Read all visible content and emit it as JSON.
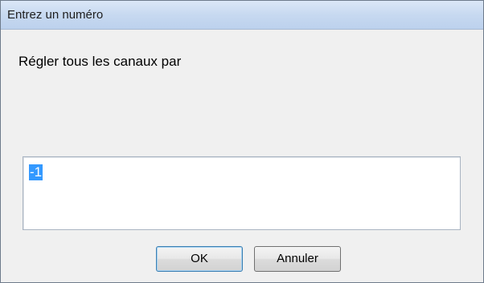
{
  "window": {
    "title": "Entrez un numéro"
  },
  "dialog": {
    "prompt": "Régler tous les canaux par",
    "input_value": "-1"
  },
  "buttons": {
    "ok_label": "OK",
    "cancel_label": "Annuler"
  },
  "colors": {
    "selection_highlight": "#3399ff",
    "titlebar": "#c7d9f0",
    "dialog_background": "#f0f0f0"
  }
}
